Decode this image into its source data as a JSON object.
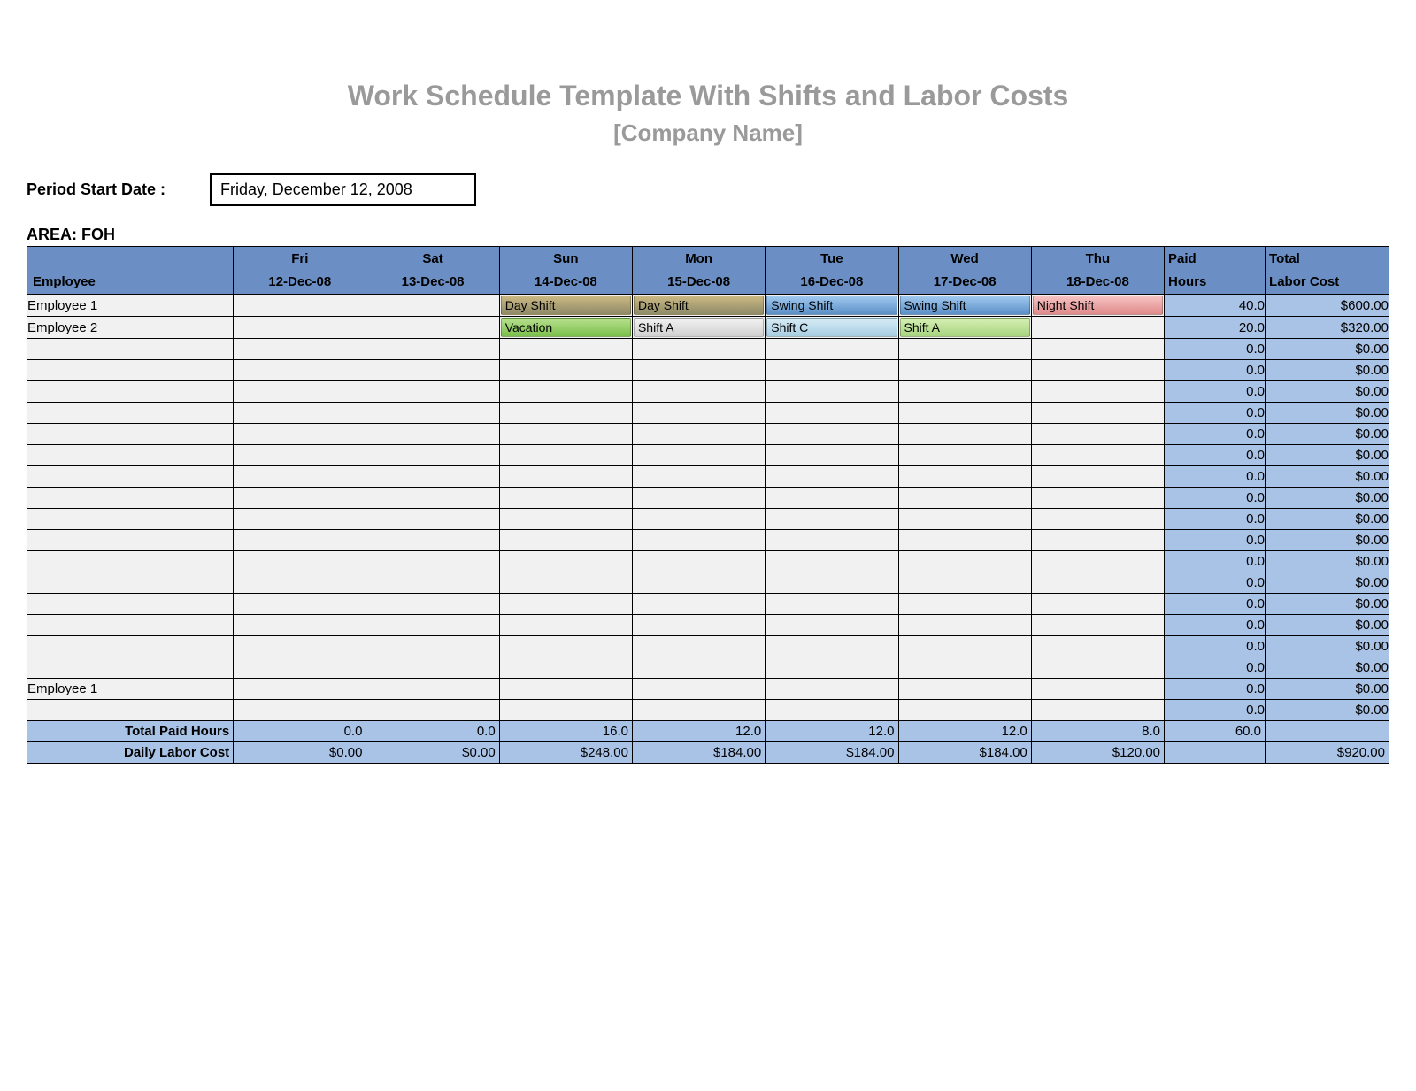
{
  "title": "Work Schedule Template With Shifts and Labor Costs",
  "subtitle": "[Company Name]",
  "period_start_label": "Period Start Date :",
  "period_start_value": "Friday, December 12, 2008",
  "area_label": "AREA: FOH",
  "headers": {
    "employee": "Employee",
    "days": [
      {
        "dow": "Fri",
        "date": "12-Dec-08"
      },
      {
        "dow": "Sat",
        "date": "13-Dec-08"
      },
      {
        "dow": "Sun",
        "date": "14-Dec-08"
      },
      {
        "dow": "Mon",
        "date": "15-Dec-08"
      },
      {
        "dow": "Tue",
        "date": "16-Dec-08"
      },
      {
        "dow": "Wed",
        "date": "17-Dec-08"
      },
      {
        "dow": "Thu",
        "date": "18-Dec-08"
      }
    ],
    "paid_hours_top": "Paid",
    "paid_hours_bottom": "Hours",
    "total_labor_cost_top": "Total",
    "total_labor_cost_bottom": "Labor Cost"
  },
  "shift_styles": {
    "Day Shift": "sh-day",
    "Swing Shift": "sh-swing",
    "Night Shift": "sh-night",
    "Vacation": "sh-vac",
    "Shift A": "sh-a",
    "Shift C": "sh-c",
    "Shift A green": "sh-ag"
  },
  "rows": [
    {
      "employee": "Employee 1",
      "cells": [
        "",
        "",
        "Day Shift",
        "Day Shift",
        "Swing Shift",
        "Swing Shift",
        "Night Shift"
      ],
      "paid_hours": "40.0",
      "labor_cost": "$600.00"
    },
    {
      "employee": "Employee 2",
      "cells": [
        "",
        "",
        "Vacation",
        "Shift A",
        "Shift C",
        "Shift A green",
        ""
      ],
      "paid_hours": "20.0",
      "labor_cost": "$320.00"
    },
    {
      "employee": "",
      "cells": [
        "",
        "",
        "",
        "",
        "",
        "",
        ""
      ],
      "paid_hours": "0.0",
      "labor_cost": "$0.00"
    },
    {
      "employee": "",
      "cells": [
        "",
        "",
        "",
        "",
        "",
        "",
        ""
      ],
      "paid_hours": "0.0",
      "labor_cost": "$0.00"
    },
    {
      "employee": "",
      "cells": [
        "",
        "",
        "",
        "",
        "",
        "",
        ""
      ],
      "paid_hours": "0.0",
      "labor_cost": "$0.00"
    },
    {
      "employee": "",
      "cells": [
        "",
        "",
        "",
        "",
        "",
        "",
        ""
      ],
      "paid_hours": "0.0",
      "labor_cost": "$0.00"
    },
    {
      "employee": "",
      "cells": [
        "",
        "",
        "",
        "",
        "",
        "",
        ""
      ],
      "paid_hours": "0.0",
      "labor_cost": "$0.00"
    },
    {
      "employee": "",
      "cells": [
        "",
        "",
        "",
        "",
        "",
        "",
        ""
      ],
      "paid_hours": "0.0",
      "labor_cost": "$0.00"
    },
    {
      "employee": "",
      "cells": [
        "",
        "",
        "",
        "",
        "",
        "",
        ""
      ],
      "paid_hours": "0.0",
      "labor_cost": "$0.00"
    },
    {
      "employee": "",
      "cells": [
        "",
        "",
        "",
        "",
        "",
        "",
        ""
      ],
      "paid_hours": "0.0",
      "labor_cost": "$0.00"
    },
    {
      "employee": "",
      "cells": [
        "",
        "",
        "",
        "",
        "",
        "",
        ""
      ],
      "paid_hours": "0.0",
      "labor_cost": "$0.00"
    },
    {
      "employee": "",
      "cells": [
        "",
        "",
        "",
        "",
        "",
        "",
        ""
      ],
      "paid_hours": "0.0",
      "labor_cost": "$0.00"
    },
    {
      "employee": "",
      "cells": [
        "",
        "",
        "",
        "",
        "",
        "",
        ""
      ],
      "paid_hours": "0.0",
      "labor_cost": "$0.00"
    },
    {
      "employee": "",
      "cells": [
        "",
        "",
        "",
        "",
        "",
        "",
        ""
      ],
      "paid_hours": "0.0",
      "labor_cost": "$0.00"
    },
    {
      "employee": "",
      "cells": [
        "",
        "",
        "",
        "",
        "",
        "",
        ""
      ],
      "paid_hours": "0.0",
      "labor_cost": "$0.00"
    },
    {
      "employee": "",
      "cells": [
        "",
        "",
        "",
        "",
        "",
        "",
        ""
      ],
      "paid_hours": "0.0",
      "labor_cost": "$0.00"
    },
    {
      "employee": "",
      "cells": [
        "",
        "",
        "",
        "",
        "",
        "",
        ""
      ],
      "paid_hours": "0.0",
      "labor_cost": "$0.00"
    },
    {
      "employee": "",
      "cells": [
        "",
        "",
        "",
        "",
        "",
        "",
        ""
      ],
      "paid_hours": "0.0",
      "labor_cost": "$0.00"
    },
    {
      "employee": "Employee 1",
      "cells": [
        "",
        "",
        "",
        "",
        "",
        "",
        ""
      ],
      "paid_hours": "0.0",
      "labor_cost": "$0.00"
    },
    {
      "employee": "",
      "cells": [
        "",
        "",
        "",
        "",
        "",
        "",
        ""
      ],
      "paid_hours": "0.0",
      "labor_cost": "$0.00"
    }
  ],
  "footer": {
    "total_paid_hours_label": "Total Paid Hours",
    "total_paid_hours": [
      "0.0",
      "0.0",
      "16.0",
      "12.0",
      "12.0",
      "12.0",
      "8.0"
    ],
    "total_paid_hours_sum": "60.0",
    "daily_labor_cost_label": "Daily Labor Cost",
    "daily_labor_cost": [
      "$0.00",
      "$0.00",
      "$248.00",
      "$184.00",
      "$184.00",
      "$184.00",
      "$120.00"
    ],
    "daily_labor_cost_sum": "$920.00"
  },
  "shift_display": {
    "Day Shift": "Day Shift",
    "Swing Shift": "Swing Shift",
    "Night Shift": "Night Shift",
    "Vacation": "Vacation",
    "Shift A": "Shift A",
    "Shift C": "Shift C",
    "Shift A green": "Shift A"
  }
}
